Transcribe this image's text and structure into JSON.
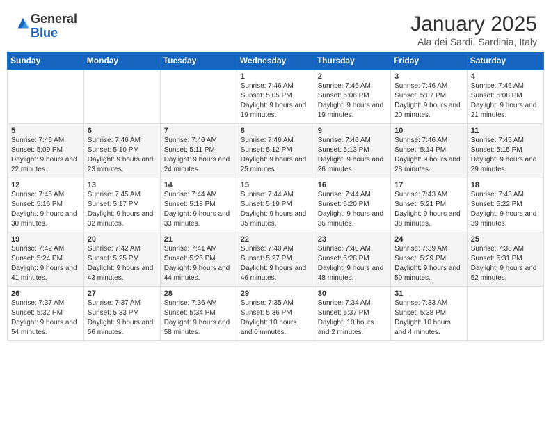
{
  "logo": {
    "general": "General",
    "blue": "Blue"
  },
  "header": {
    "month": "January 2025",
    "location": "Ala dei Sardi, Sardinia, Italy"
  },
  "weekdays": [
    "Sunday",
    "Monday",
    "Tuesday",
    "Wednesday",
    "Thursday",
    "Friday",
    "Saturday"
  ],
  "weeks": [
    [
      {
        "day": "",
        "info": ""
      },
      {
        "day": "",
        "info": ""
      },
      {
        "day": "",
        "info": ""
      },
      {
        "day": "1",
        "info": "Sunrise: 7:46 AM\nSunset: 5:05 PM\nDaylight: 9 hours and 19 minutes."
      },
      {
        "day": "2",
        "info": "Sunrise: 7:46 AM\nSunset: 5:06 PM\nDaylight: 9 hours and 19 minutes."
      },
      {
        "day": "3",
        "info": "Sunrise: 7:46 AM\nSunset: 5:07 PM\nDaylight: 9 hours and 20 minutes."
      },
      {
        "day": "4",
        "info": "Sunrise: 7:46 AM\nSunset: 5:08 PM\nDaylight: 9 hours and 21 minutes."
      }
    ],
    [
      {
        "day": "5",
        "info": "Sunrise: 7:46 AM\nSunset: 5:09 PM\nDaylight: 9 hours and 22 minutes."
      },
      {
        "day": "6",
        "info": "Sunrise: 7:46 AM\nSunset: 5:10 PM\nDaylight: 9 hours and 23 minutes."
      },
      {
        "day": "7",
        "info": "Sunrise: 7:46 AM\nSunset: 5:11 PM\nDaylight: 9 hours and 24 minutes."
      },
      {
        "day": "8",
        "info": "Sunrise: 7:46 AM\nSunset: 5:12 PM\nDaylight: 9 hours and 25 minutes."
      },
      {
        "day": "9",
        "info": "Sunrise: 7:46 AM\nSunset: 5:13 PM\nDaylight: 9 hours and 26 minutes."
      },
      {
        "day": "10",
        "info": "Sunrise: 7:46 AM\nSunset: 5:14 PM\nDaylight: 9 hours and 28 minutes."
      },
      {
        "day": "11",
        "info": "Sunrise: 7:45 AM\nSunset: 5:15 PM\nDaylight: 9 hours and 29 minutes."
      }
    ],
    [
      {
        "day": "12",
        "info": "Sunrise: 7:45 AM\nSunset: 5:16 PM\nDaylight: 9 hours and 30 minutes."
      },
      {
        "day": "13",
        "info": "Sunrise: 7:45 AM\nSunset: 5:17 PM\nDaylight: 9 hours and 32 minutes."
      },
      {
        "day": "14",
        "info": "Sunrise: 7:44 AM\nSunset: 5:18 PM\nDaylight: 9 hours and 33 minutes."
      },
      {
        "day": "15",
        "info": "Sunrise: 7:44 AM\nSunset: 5:19 PM\nDaylight: 9 hours and 35 minutes."
      },
      {
        "day": "16",
        "info": "Sunrise: 7:44 AM\nSunset: 5:20 PM\nDaylight: 9 hours and 36 minutes."
      },
      {
        "day": "17",
        "info": "Sunrise: 7:43 AM\nSunset: 5:21 PM\nDaylight: 9 hours and 38 minutes."
      },
      {
        "day": "18",
        "info": "Sunrise: 7:43 AM\nSunset: 5:22 PM\nDaylight: 9 hours and 39 minutes."
      }
    ],
    [
      {
        "day": "19",
        "info": "Sunrise: 7:42 AM\nSunset: 5:24 PM\nDaylight: 9 hours and 41 minutes."
      },
      {
        "day": "20",
        "info": "Sunrise: 7:42 AM\nSunset: 5:25 PM\nDaylight: 9 hours and 43 minutes."
      },
      {
        "day": "21",
        "info": "Sunrise: 7:41 AM\nSunset: 5:26 PM\nDaylight: 9 hours and 44 minutes."
      },
      {
        "day": "22",
        "info": "Sunrise: 7:40 AM\nSunset: 5:27 PM\nDaylight: 9 hours and 46 minutes."
      },
      {
        "day": "23",
        "info": "Sunrise: 7:40 AM\nSunset: 5:28 PM\nDaylight: 9 hours and 48 minutes."
      },
      {
        "day": "24",
        "info": "Sunrise: 7:39 AM\nSunset: 5:29 PM\nDaylight: 9 hours and 50 minutes."
      },
      {
        "day": "25",
        "info": "Sunrise: 7:38 AM\nSunset: 5:31 PM\nDaylight: 9 hours and 52 minutes."
      }
    ],
    [
      {
        "day": "26",
        "info": "Sunrise: 7:37 AM\nSunset: 5:32 PM\nDaylight: 9 hours and 54 minutes."
      },
      {
        "day": "27",
        "info": "Sunrise: 7:37 AM\nSunset: 5:33 PM\nDaylight: 9 hours and 56 minutes."
      },
      {
        "day": "28",
        "info": "Sunrise: 7:36 AM\nSunset: 5:34 PM\nDaylight: 9 hours and 58 minutes."
      },
      {
        "day": "29",
        "info": "Sunrise: 7:35 AM\nSunset: 5:36 PM\nDaylight: 10 hours and 0 minutes."
      },
      {
        "day": "30",
        "info": "Sunrise: 7:34 AM\nSunset: 5:37 PM\nDaylight: 10 hours and 2 minutes."
      },
      {
        "day": "31",
        "info": "Sunrise: 7:33 AM\nSunset: 5:38 PM\nDaylight: 10 hours and 4 minutes."
      },
      {
        "day": "",
        "info": ""
      }
    ]
  ]
}
